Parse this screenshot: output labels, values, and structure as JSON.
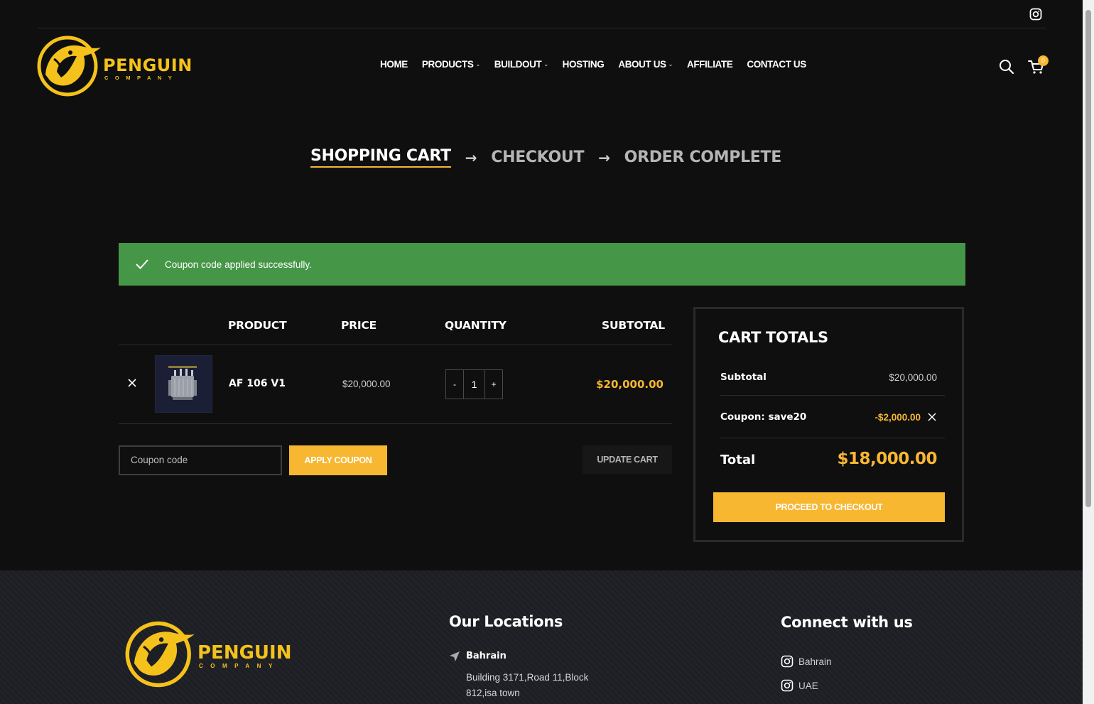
{
  "header": {
    "logo_main": "PENGUIN",
    "logo_sub": "COMPANY",
    "nav": [
      {
        "label": "HOME",
        "dropdown": false
      },
      {
        "label": "PRODUCTS",
        "dropdown": true
      },
      {
        "label": "BUILDOUT",
        "dropdown": true
      },
      {
        "label": "HOSTING",
        "dropdown": false
      },
      {
        "label": "ABOUT US",
        "dropdown": true
      },
      {
        "label": "AFFILIATE",
        "dropdown": false
      },
      {
        "label": "CONTACT US",
        "dropdown": false
      }
    ],
    "cart_count": "0"
  },
  "steps": {
    "cart": "SHOPPING CART",
    "arrow": "→",
    "checkout": "CHECKOUT",
    "complete": "ORDER COMPLETE"
  },
  "notice": {
    "message": "Coupon code applied successfully."
  },
  "cart_table": {
    "headers": {
      "product": "PRODUCT",
      "price": "PRICE",
      "quantity": "QUANTITY",
      "subtotal": "SUBTOTAL"
    },
    "items": [
      {
        "name": "AF 106 V1",
        "price": "$20,000.00",
        "qty": "1",
        "subtotal": "$20,000.00",
        "qty_minus": "-",
        "qty_plus": "+"
      }
    ],
    "coupon_placeholder": "Coupon code",
    "apply_label": "APPLY COUPON",
    "update_label": "UPDATE CART"
  },
  "totals": {
    "title": "CART TOTALS",
    "subtotal_label": "Subtotal",
    "subtotal_value": "$20,000.00",
    "coupon_label": "Coupon: save20",
    "coupon_value": "-$2,000.00",
    "total_label": "Total",
    "total_value": "$18,000.00",
    "checkout_label": "PROCEED TO CHECKOUT"
  },
  "footer": {
    "logo_main": "PENGUIN",
    "logo_sub": "COMPANY",
    "locations_title": "Our Locations",
    "location_name": "Bahrain",
    "location_address": "Building 3171,Road 11,Block 812,isa town",
    "connect_title": "Connect with us",
    "socials": [
      {
        "label": "Bahrain",
        "icon": "instagram-icon"
      },
      {
        "label": "UAE",
        "icon": "instagram-icon"
      }
    ]
  },
  "colors": {
    "accent": "#f7b731",
    "logo": "#f4c21b",
    "success": "#459646",
    "background": "#0f0f10"
  }
}
